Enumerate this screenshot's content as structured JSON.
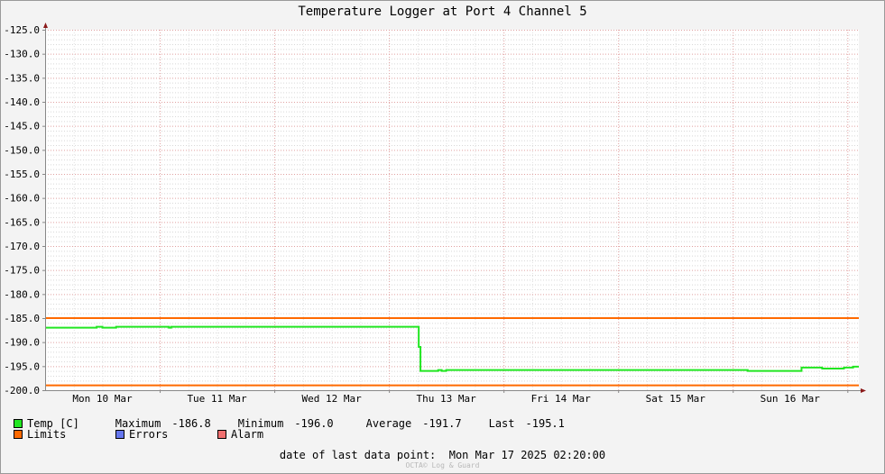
{
  "chart_data": {
    "type": "line",
    "title": "Temperature Logger at Port 4 Channel 5",
    "ylim": [
      -200,
      -125
    ],
    "yticks": [
      "-125.0",
      "-130.0",
      "-135.0",
      "-140.0",
      "-145.0",
      "-150.0",
      "-155.0",
      "-160.0",
      "-165.0",
      "-170.0",
      "-175.0",
      "-180.0",
      "-185.0",
      "-190.0",
      "-195.0",
      "-200.0"
    ],
    "xlim": [
      0,
      7.1
    ],
    "xticks": [
      {
        "x": 0.5,
        "label": "Mon 10 Mar"
      },
      {
        "x": 1.5,
        "label": "Tue 11 Mar"
      },
      {
        "x": 2.5,
        "label": "Wed 12 Mar"
      },
      {
        "x": 3.5,
        "label": "Thu 13 Mar"
      },
      {
        "x": 4.5,
        "label": "Fri 14 Mar"
      },
      {
        "x": 5.5,
        "label": "Sat 15 Mar"
      },
      {
        "x": 6.5,
        "label": "Sun 16 Mar"
      }
    ],
    "grid": true,
    "series": [
      {
        "name": "Temp [C]",
        "color": "#22e622",
        "points": [
          [
            0,
            -187.0
          ],
          [
            0.42,
            -187.0
          ],
          [
            0.45,
            -186.8
          ],
          [
            0.5,
            -187.0
          ],
          [
            0.58,
            -187.0
          ],
          [
            0.62,
            -186.8
          ],
          [
            1.05,
            -186.8
          ],
          [
            1.08,
            -187.0
          ],
          [
            1.1,
            -186.8
          ],
          [
            3.25,
            -186.8
          ],
          [
            3.26,
            -191.0
          ],
          [
            3.275,
            -196.0
          ],
          [
            3.4,
            -196.0
          ],
          [
            3.43,
            -195.8
          ],
          [
            3.46,
            -196.0
          ],
          [
            3.5,
            -195.8
          ],
          [
            6.1,
            -195.8
          ],
          [
            6.13,
            -196.0
          ],
          [
            6.55,
            -196.0
          ],
          [
            6.6,
            -195.3
          ],
          [
            6.75,
            -195.3
          ],
          [
            6.78,
            -195.5
          ],
          [
            6.92,
            -195.5
          ],
          [
            6.97,
            -195.3
          ],
          [
            7.05,
            -195.1
          ],
          [
            7.1,
            -195.1
          ]
        ]
      }
    ],
    "limits": {
      "name": "Limits",
      "color": "#ff6a00",
      "values": [
        -185.0,
        -199.0
      ]
    }
  },
  "legend": {
    "temp": {
      "label": "Temp [C]",
      "color": "#22e622"
    },
    "limits": {
      "label": "Limits",
      "color": "#ff6a00"
    },
    "errors": {
      "label": "Errors",
      "color": "#6677ee"
    },
    "alarm": {
      "label": "Alarm",
      "color": "#f07070"
    },
    "stats": {
      "maximum_label": "Maximum",
      "maximum": "-186.8",
      "minimum_label": "Minimum",
      "minimum": "-196.0",
      "average_label": "Average",
      "average": "-191.7",
      "last_label": "Last",
      "last": "-195.1"
    }
  },
  "footer": {
    "last_point_label": "date of last data point:",
    "last_point_value": "Mon Mar 17 2025 02:20:00",
    "watermark": "OCTA© Log & Guard"
  }
}
